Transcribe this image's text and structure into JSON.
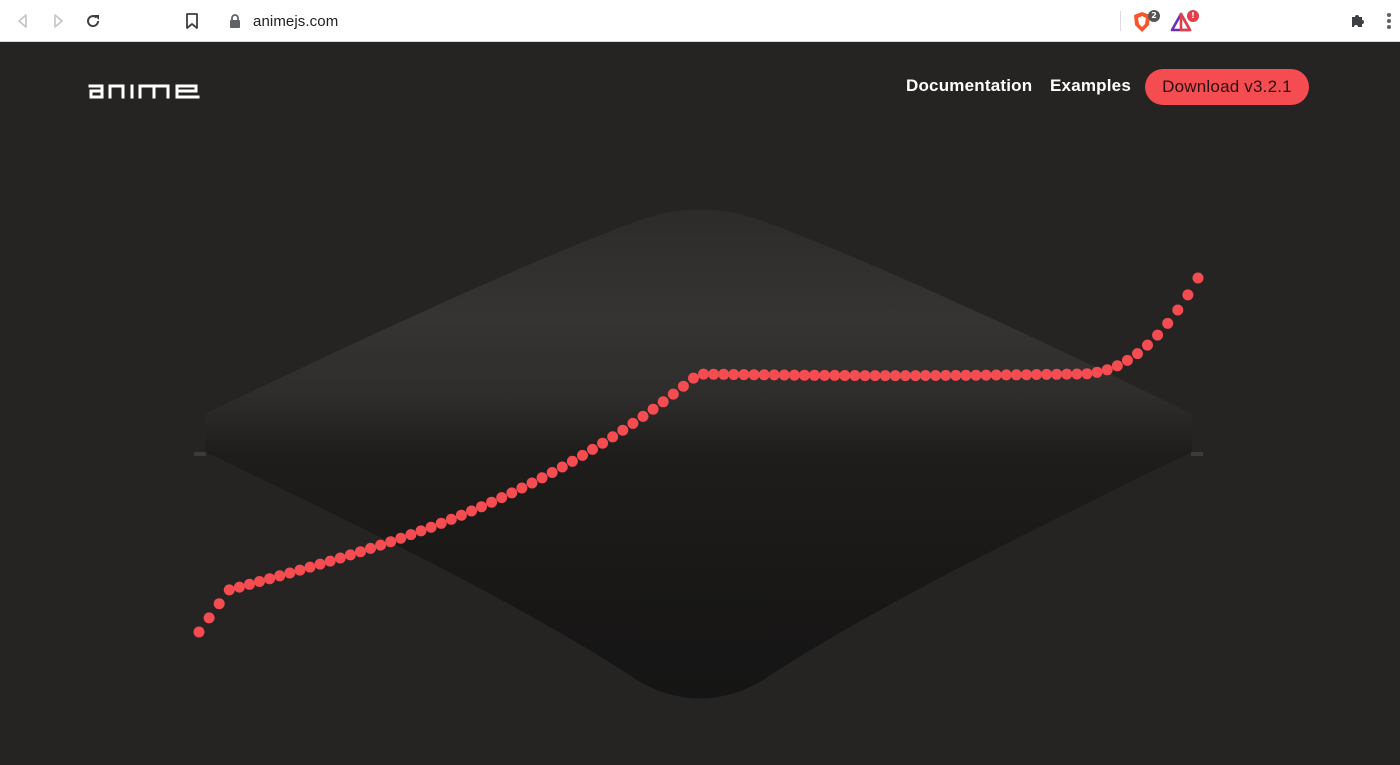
{
  "browser": {
    "url": "animejs.com",
    "extensions": [
      {
        "name": "brave-shields-icon",
        "badge": "2",
        "badge_color": "#555555"
      },
      {
        "name": "brave-rewards-icon",
        "badge": "!",
        "badge_color": "#e0404a"
      }
    ]
  },
  "site": {
    "logo_text": "anime",
    "nav": {
      "documentation": "Documentation",
      "examples": "Examples",
      "download": "Download v3.2.1"
    },
    "colors": {
      "background": "#252423",
      "accent": "#f54c51",
      "text": "#ffffff"
    }
  },
  "animation": {
    "dot_count": 100,
    "dot_color": "#f54c51",
    "shape_color_top": "#3a3938",
    "shape_color_bottom": "#171616"
  }
}
